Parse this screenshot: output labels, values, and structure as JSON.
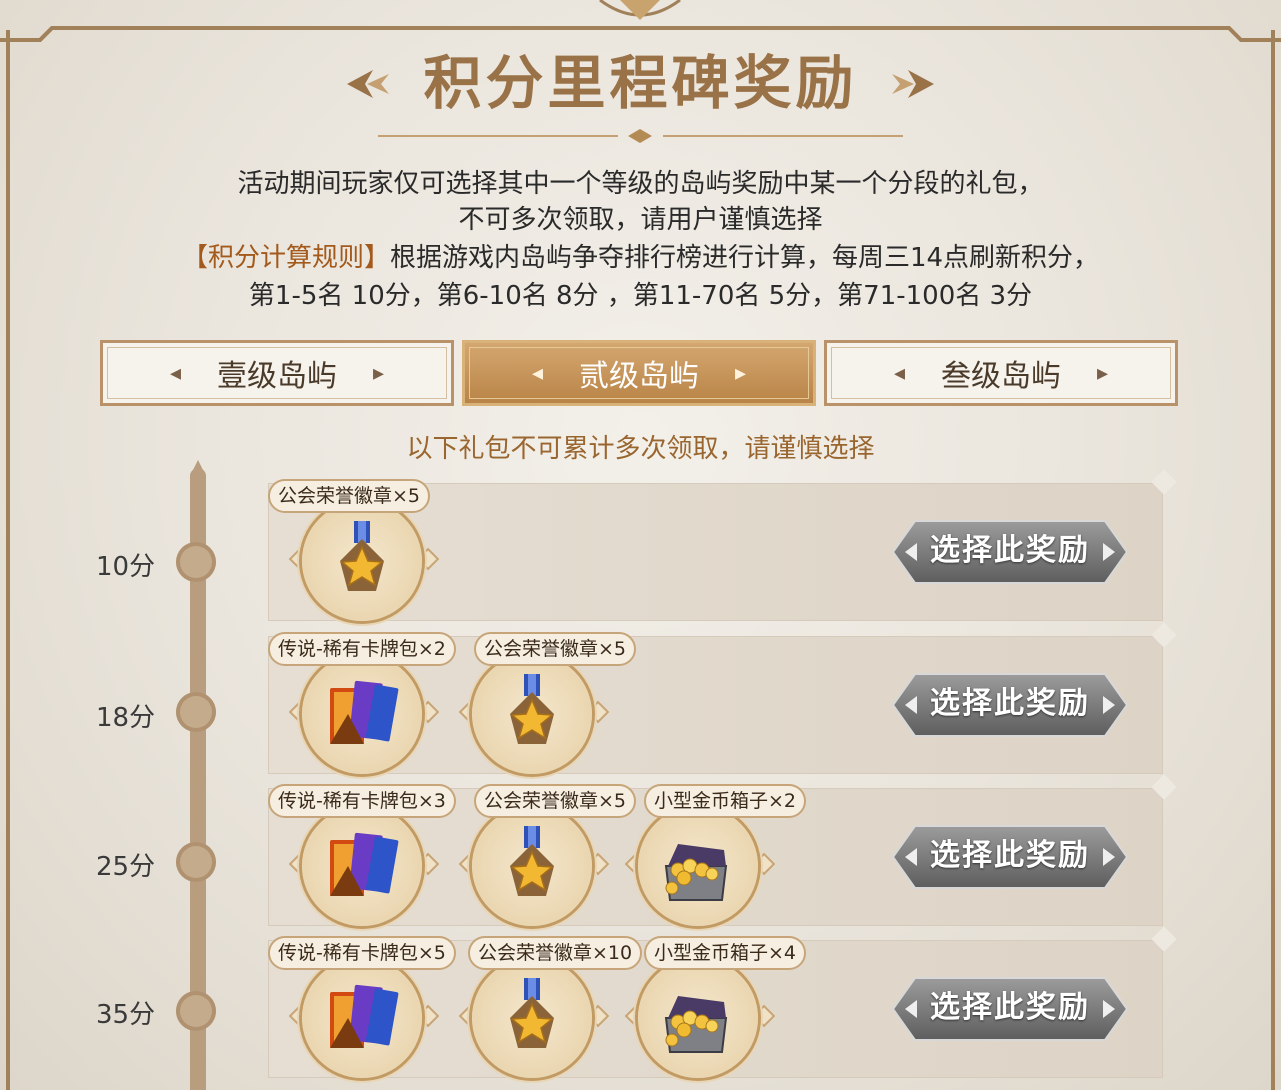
{
  "header": {
    "title": "积分里程碑奖励"
  },
  "description": {
    "line1": "活动期间玩家仅可选择其中一个等级的岛屿奖励中某一个分段的礼包，",
    "line2": "不可多次领取，请用户谨慎选择",
    "rule_label": "【积分计算规则】",
    "rule_text": "根据游戏内岛屿争夺排行榜进行计算，每周三14点刷新积分，",
    "line4": "第1-5名 10分，第6-10名 8分 ，第11-70名 5分，第71-100名 3分"
  },
  "tabs": [
    {
      "label": "壹级岛屿",
      "active": false
    },
    {
      "label": "贰级岛屿",
      "active": true
    },
    {
      "label": "叁级岛屿",
      "active": false
    }
  ],
  "notice": "以下礼包不可累计多次领取，请谨慎选择",
  "button_label": "选择此奖励",
  "tiers": [
    {
      "score": "10分",
      "items": [
        {
          "name": "公会荣誉徽章×5",
          "icon": "medal"
        }
      ]
    },
    {
      "score": "18分",
      "items": [
        {
          "name": "传说-稀有卡牌包×2",
          "icon": "card-pack"
        },
        {
          "name": "公会荣誉徽章×5",
          "icon": "medal"
        }
      ]
    },
    {
      "score": "25分",
      "items": [
        {
          "name": "传说-稀有卡牌包×3",
          "icon": "card-pack"
        },
        {
          "name": "公会荣誉徽章×5",
          "icon": "medal"
        },
        {
          "name": "小型金币箱子×2",
          "icon": "gold-chest"
        }
      ]
    },
    {
      "score": "35分",
      "items": [
        {
          "name": "传说-稀有卡牌包×5",
          "icon": "card-pack"
        },
        {
          "name": "公会荣誉徽章×10",
          "icon": "medal"
        },
        {
          "name": "小型金币箱子×4",
          "icon": "gold-chest"
        }
      ]
    }
  ],
  "colors": {
    "accent": "#b98447",
    "title": "#9a7248",
    "rule": "#a35a1c",
    "timeline": "#b89d7e"
  }
}
